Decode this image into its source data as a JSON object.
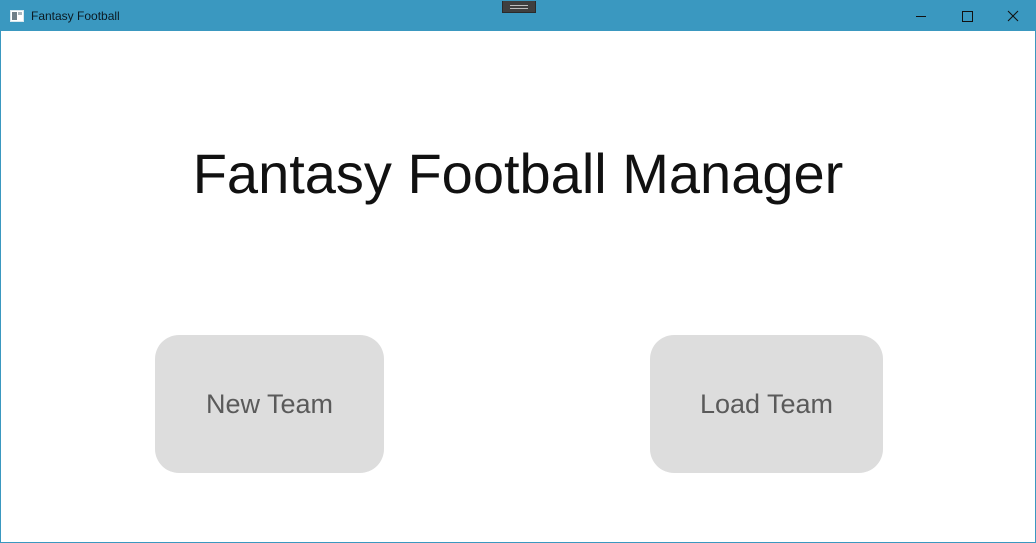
{
  "window": {
    "title": "Fantasy Football",
    "controls": {
      "minimize_icon": "minimize-icon",
      "maximize_icon": "maximize-icon",
      "close_icon": "close-icon"
    },
    "titlebar_color": "#3a98c0"
  },
  "main": {
    "heading": "Fantasy Football Manager",
    "buttons": {
      "new_team": "New Team",
      "load_team": "Load Team"
    },
    "button_color": "#dddddd",
    "button_text_color": "#5a5a5a"
  }
}
